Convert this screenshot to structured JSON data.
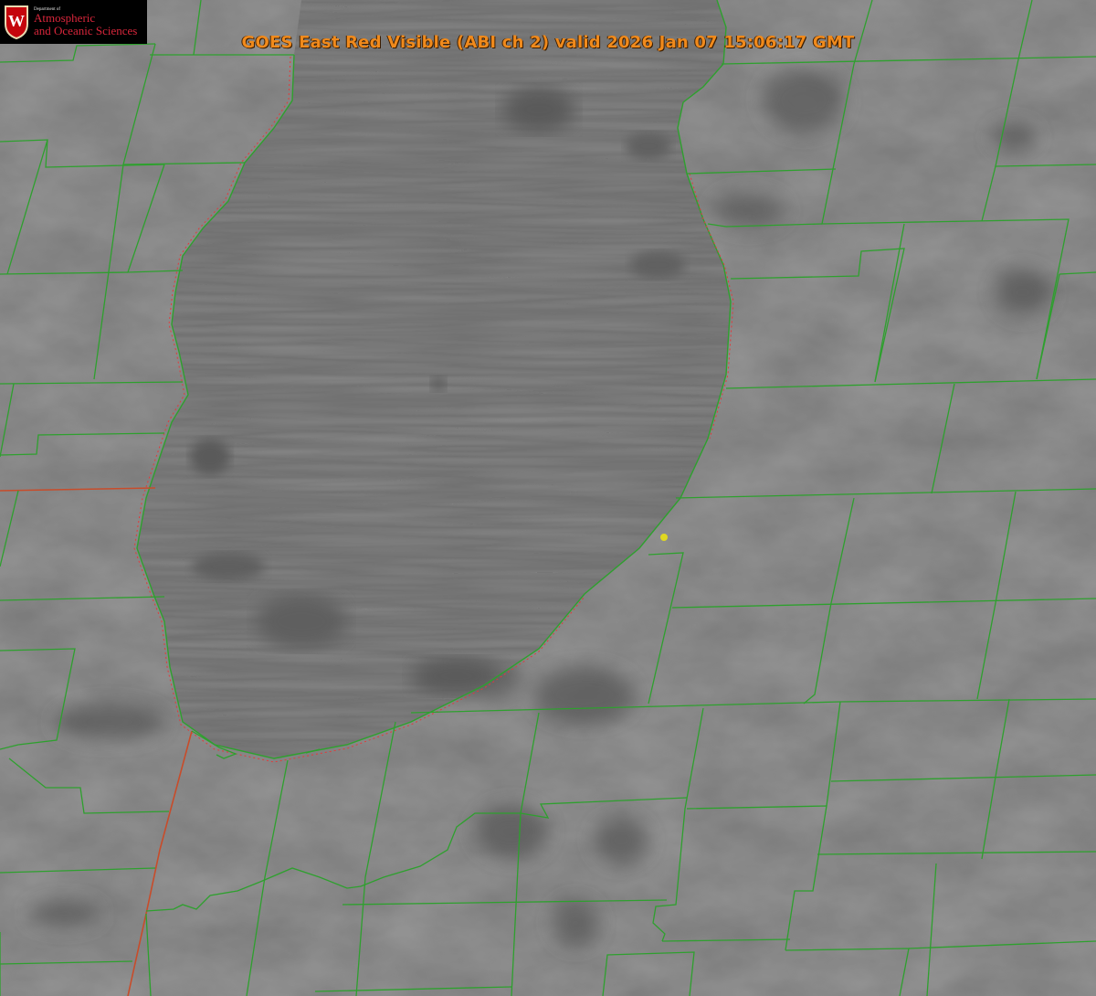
{
  "title": "GOES East Red Visible (ABI ch 2) valid 2026 Jan 07 15:06:17 GMT",
  "logo": {
    "dept": "Department of",
    "line1": "Atmospheric",
    "line2": "and Oceanic Sciences",
    "crest_letter": "W"
  },
  "colors": {
    "county_border": "#2ea02e",
    "state_border": "#d23a2a",
    "shoreline_dotted": "#e23a3a",
    "title": "#f08a1c",
    "marker": "#e0d820",
    "land_gray": "#7b7b7b",
    "lake_gray": "#6f6f6f",
    "logo_red": "#c5050c"
  },
  "map": {
    "subject": "Lake Michigan (southern basin) with surrounding county outlines",
    "marker_icon": "yellow-dot-icon"
  }
}
